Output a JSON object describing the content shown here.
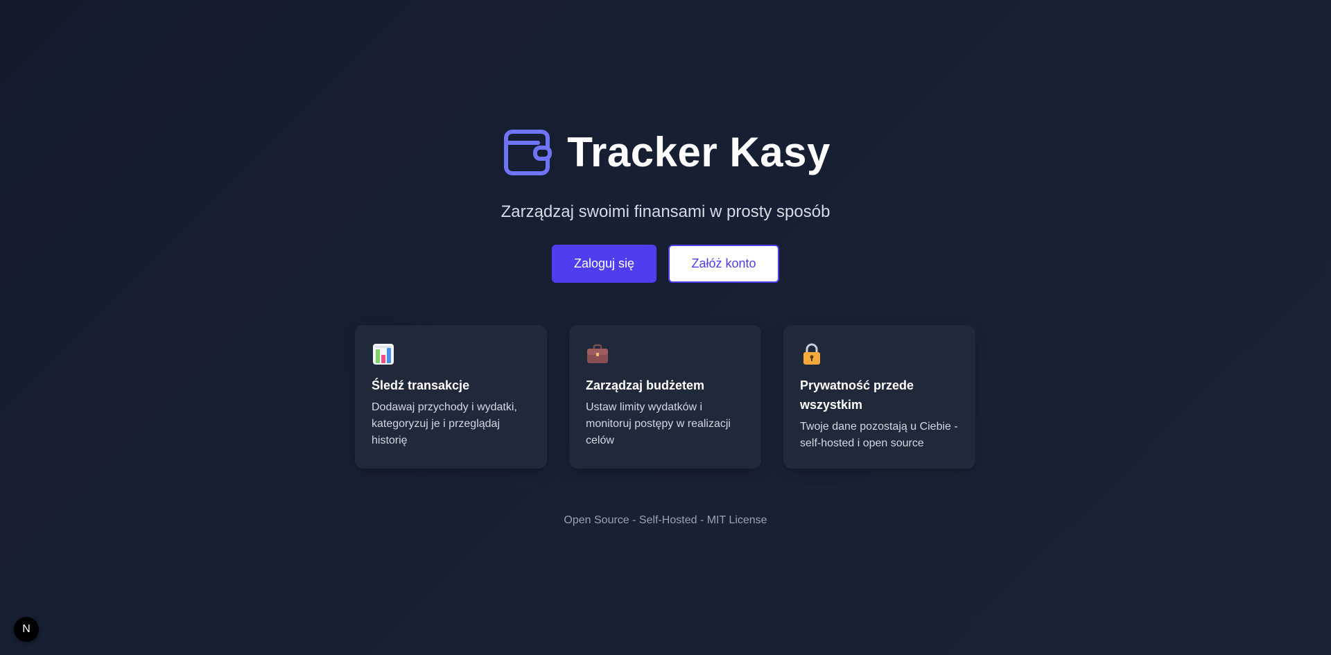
{
  "hero": {
    "brand_icon": "wallet-icon",
    "title": "Tracker Kasy",
    "subtitle": "Zarządzaj swoimi finansami w prosty sposób"
  },
  "actions": {
    "login_label": "Zaloguj się",
    "register_label": "Załóż konto"
  },
  "features": [
    {
      "icon": "bar-chart-icon",
      "title": "Śledź transakcje",
      "description": "Dodawaj przychody i wydatki, kategoryzuj je i przeglądaj historię"
    },
    {
      "icon": "briefcase-icon",
      "title": "Zarządzaj budżetem",
      "description": "Ustaw limity wydatków i monitoruj postępy w realizacji celów"
    },
    {
      "icon": "lock-icon",
      "title": "Prywatność przede wszystkim",
      "description": "Twoje dane pozostają u Ciebie - self-hosted i open source"
    }
  ],
  "footer": {
    "text": "Open Source - Self-Hosted - MIT License"
  },
  "dev_badge": {
    "label": "N"
  },
  "colors": {
    "background": "#172033",
    "card": "#1f293a",
    "accent": "#4f3df0",
    "brand_icon": "#6e74f5",
    "footer_text": "#9aa3b2"
  }
}
